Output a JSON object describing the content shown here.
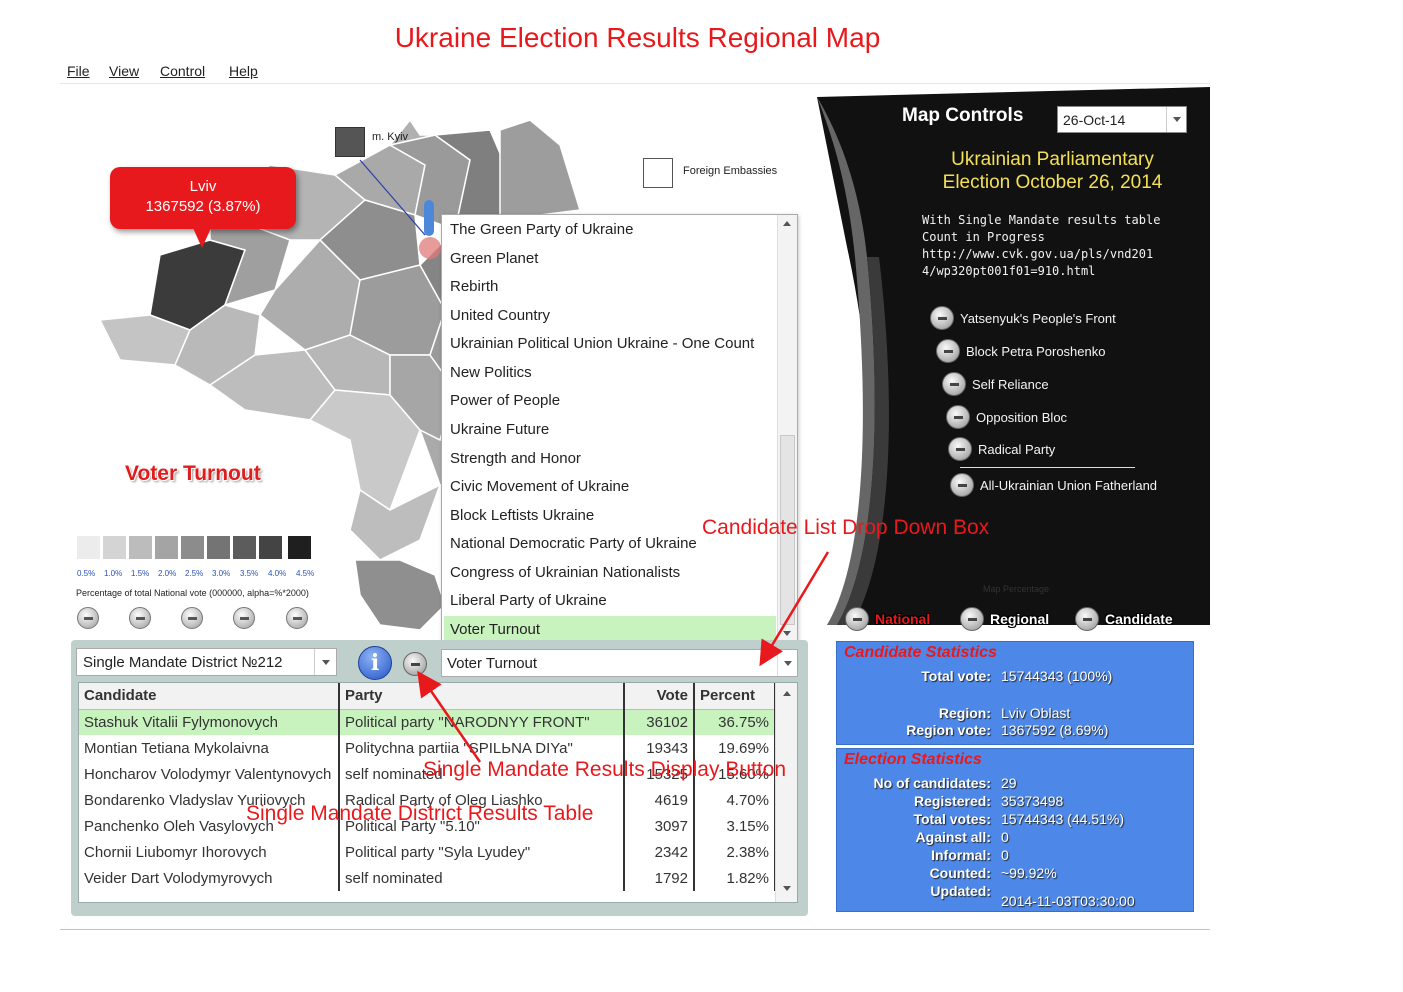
{
  "page_title": "Ukraine Election Results Regional Map",
  "menu": [
    "File",
    "View",
    "Control",
    "Help"
  ],
  "map": {
    "kyiv_label": "m. Kyiv",
    "embassy_label": "Foreign Embassies",
    "tooltip": {
      "region": "Lviv",
      "value": "1367592 (3.87%)"
    },
    "layer_label": "Voter Turnout",
    "legend": {
      "ticks": [
        "0.5%",
        "1.0%",
        "1.5%",
        "2.0%",
        "2.5%",
        "3.0%",
        "3.5%",
        "4.0%",
        "4.5%"
      ],
      "colors": [
        "#ececec",
        "#d4d4d4",
        "#bcbcbc",
        "#a4a4a4",
        "#8c8c8c",
        "#747474",
        "#5c5c5c",
        "#444444",
        "#1f1f1f"
      ],
      "caption": "Percentage of total National vote (000000, alpha=%*2000)"
    }
  },
  "party_list": {
    "items": [
      "The Green Party of Ukraine",
      "Green Planet",
      "Rebirth",
      "United Country",
      "Ukrainian Political Union Ukraine - One Count",
      "New Politics",
      "Power of People",
      "Ukraine Future",
      "Strength and Honor",
      "Civic Movement of Ukraine",
      "Block Leftists Ukraine",
      "National Democratic Party of Ukraine",
      "Congress of Ukrainian Nationalists",
      "Liberal Party of Ukraine",
      "Voter Turnout"
    ],
    "selected": "Voter Turnout"
  },
  "district_select": {
    "value": "Single Mandate District №212"
  },
  "turnout_select": {
    "value": "Voter Turnout"
  },
  "results_table": {
    "headers": [
      "Candidate",
      "Party",
      "Vote",
      "Percent"
    ],
    "rows": [
      {
        "candidate": "Stashuk Vitalii Fylymonovych",
        "party": "Political party \"NARODNYY FRONT\"",
        "vote": "36102",
        "percent": "36.75%"
      },
      {
        "candidate": "Montian Tetiana Mykolaivna",
        "party": "Politychna partiia \"SPILЬNA DIYa\"",
        "vote": "19343",
        "percent": "19.69%"
      },
      {
        "candidate": "Honcharov Volodymyr Valentynovych",
        "party": "self nominated",
        "vote": "15325",
        "percent": "15.60%"
      },
      {
        "candidate": "Bondarenko Vladyslav Yuriiovych",
        "party": "Radical Party of Oleg Liashko",
        "vote": "4619",
        "percent": "4.70%"
      },
      {
        "candidate": "Panchenko Oleh Vasylovych",
        "party": "Political Party \"5.10\"",
        "vote": "3097",
        "percent": "3.15%"
      },
      {
        "candidate": "Chornii Liubomyr Ihorovych",
        "party": "Political party \"Syla Lyudey\"",
        "vote": "2342",
        "percent": "2.38%"
      },
      {
        "candidate": "Veider Dart Volodymyrovych",
        "party": "self nominated",
        "vote": "1792",
        "percent": "1.82%"
      }
    ]
  },
  "map_controls": {
    "title": "Map Controls",
    "date": "26-Oct-14",
    "election_title_line1": "Ukrainian Parliamentary",
    "election_title_line2": "Election October 26, 2014",
    "note_line1": "With Single Mandate results table",
    "note_line2": "Count in Progress",
    "note_line3": "http://www.cvk.gov.ua/pls/vnd201",
    "note_line4": "4/wp320pt001f01=910.html",
    "parties": [
      "Yatsenyuk's People's Front",
      "Block Petra Poroshenko",
      "Self Reliance",
      "Opposition Bloc",
      "Radical Party",
      "All-Ukrainian Union Fatherland"
    ]
  },
  "map_percentage": {
    "label": "Map Percentage",
    "buttons": [
      "National",
      "Regional",
      "Candidate"
    ]
  },
  "candidate_statistics": {
    "title": "Candidate Statistics",
    "total_vote_label": "Total vote:",
    "total_vote": "15744343 (100%)",
    "region_label": "Region:",
    "region": "Lviv Oblast",
    "region_vote_label": "Region vote:",
    "region_vote": "1367592   (8.69%)"
  },
  "election_statistics": {
    "title": "Election Statistics",
    "rows": [
      {
        "label": "No of candidates:",
        "value": "29"
      },
      {
        "label": "Registered:",
        "value": "35373498"
      },
      {
        "label": "Total votes:",
        "value": "15744343   (44.51%)"
      },
      {
        "label": "Against all:",
        "value": "0"
      },
      {
        "label": "Informal:",
        "value": "0"
      },
      {
        "label": "Counted:",
        "value": "~99.92%"
      },
      {
        "label": "Updated:",
        "value": "2014-11-03T03:30:00"
      }
    ]
  },
  "annotations": {
    "dropdown": "Candidate List Drop Down Box",
    "display_button": "Single Mandate Results Display Button",
    "results_table": "Single Mandate District Results Table"
  },
  "colors": {
    "accent_red": "#e8191c",
    "stats_blue": "#4d88e8",
    "selected_green": "#c8f3bf",
    "title_yellow": "#f3e055"
  }
}
